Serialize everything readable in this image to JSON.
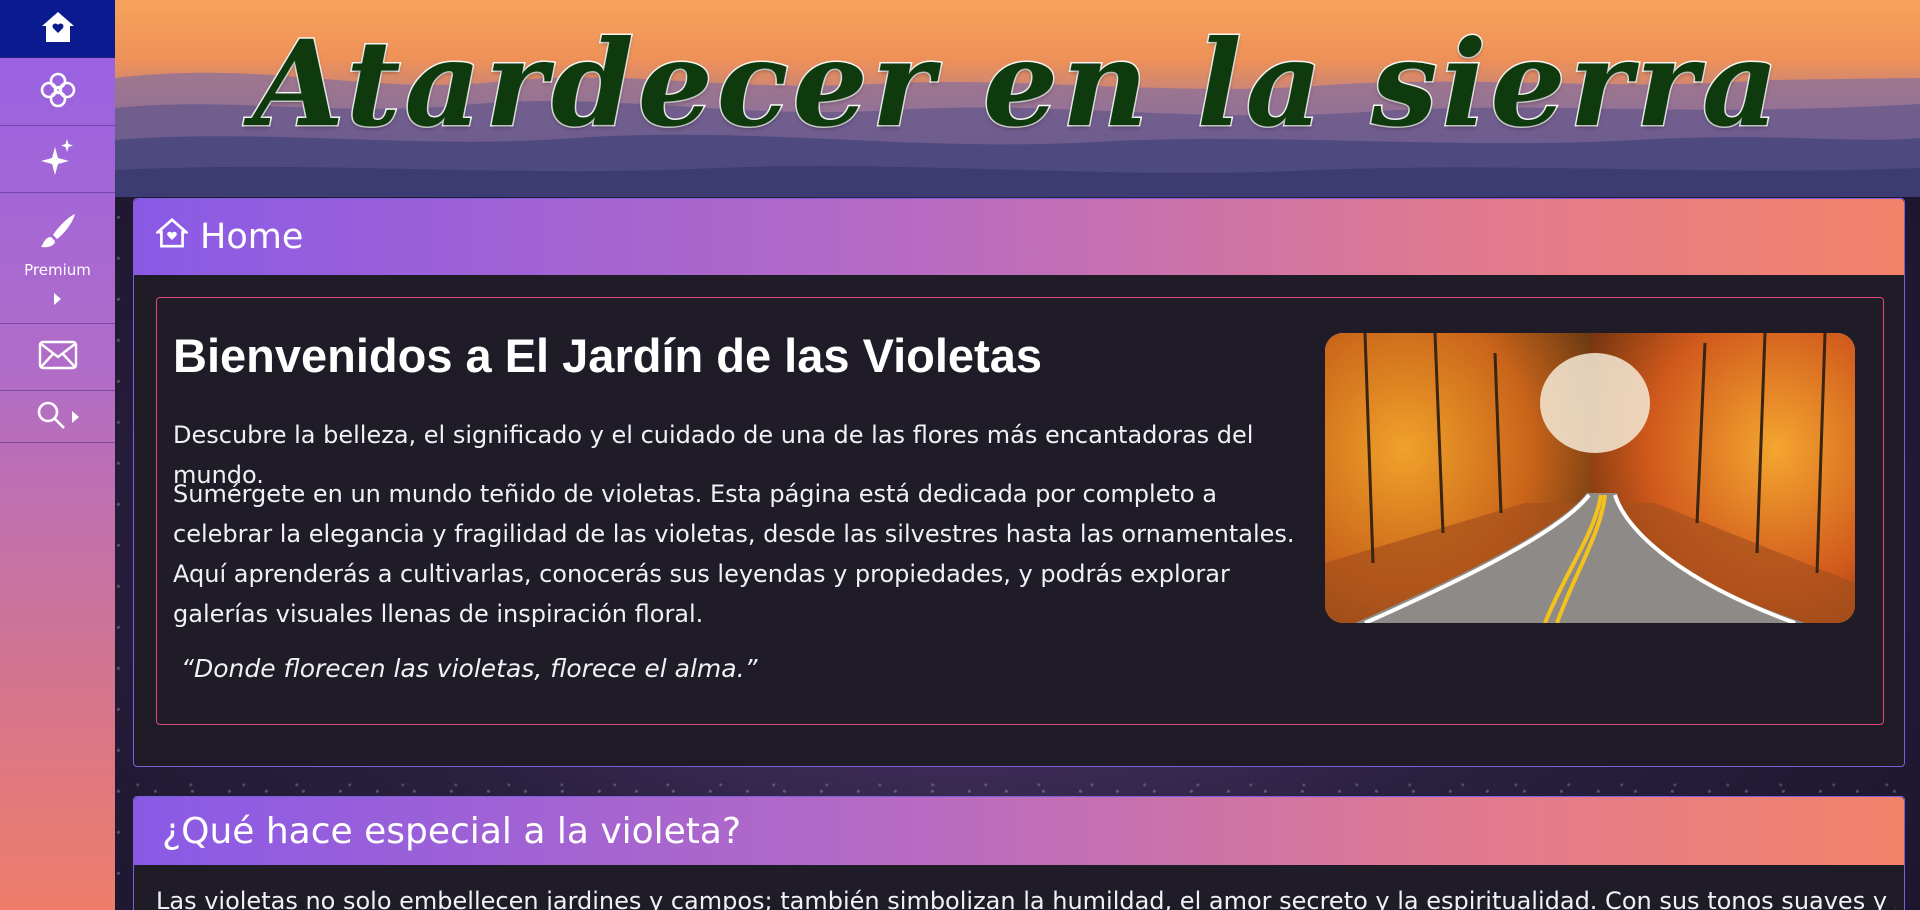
{
  "sidebar": {
    "items": [
      {
        "icon": "home-icon",
        "active": true
      },
      {
        "icon": "flower-icon"
      },
      {
        "icon": "sparkles-icon"
      },
      {
        "icon": "paintbrush-icon",
        "label": "Premium"
      },
      {
        "icon": "envelope-icon"
      },
      {
        "icon": "search-icon"
      }
    ],
    "active_color": "#0b1b8f"
  },
  "banner": {
    "title": "Atardecer en la sierra"
  },
  "home_panel": {
    "heading": "Home",
    "welcome_title": "Bienvenidos a El Jardín de las Violetas",
    "intro": "Descubre la belleza, el significado y el cuidado de una de las flores más encantadoras del mundo.",
    "body": "Sumérgete en un mundo teñido de violetas. Esta página está dedicada por completo a celebrar la elegancia y fragilidad de las violetas, desde las silvestres hasta las ornamentales. Aquí aprenderás a cultivarlas, conocerás sus leyendas y propiedades, y podrás explorar galerías visuales llenas de inspiración floral.",
    "quote": "“Donde florecen las violetas, florece el alma.”"
  },
  "special_panel": {
    "heading": "¿Qué hace especial a la violeta?",
    "text": "Las violetas no solo embellecen jardines y campos; también simbolizan la humildad, el amor secreto y la espiritualidad. Con sus tonos suaves y su"
  },
  "colors": {
    "panel_bg": "#1f1c28",
    "accent_pink": "#e0487a",
    "header_gradient_start": "#8a5ae6",
    "header_gradient_end": "#f4836a"
  }
}
